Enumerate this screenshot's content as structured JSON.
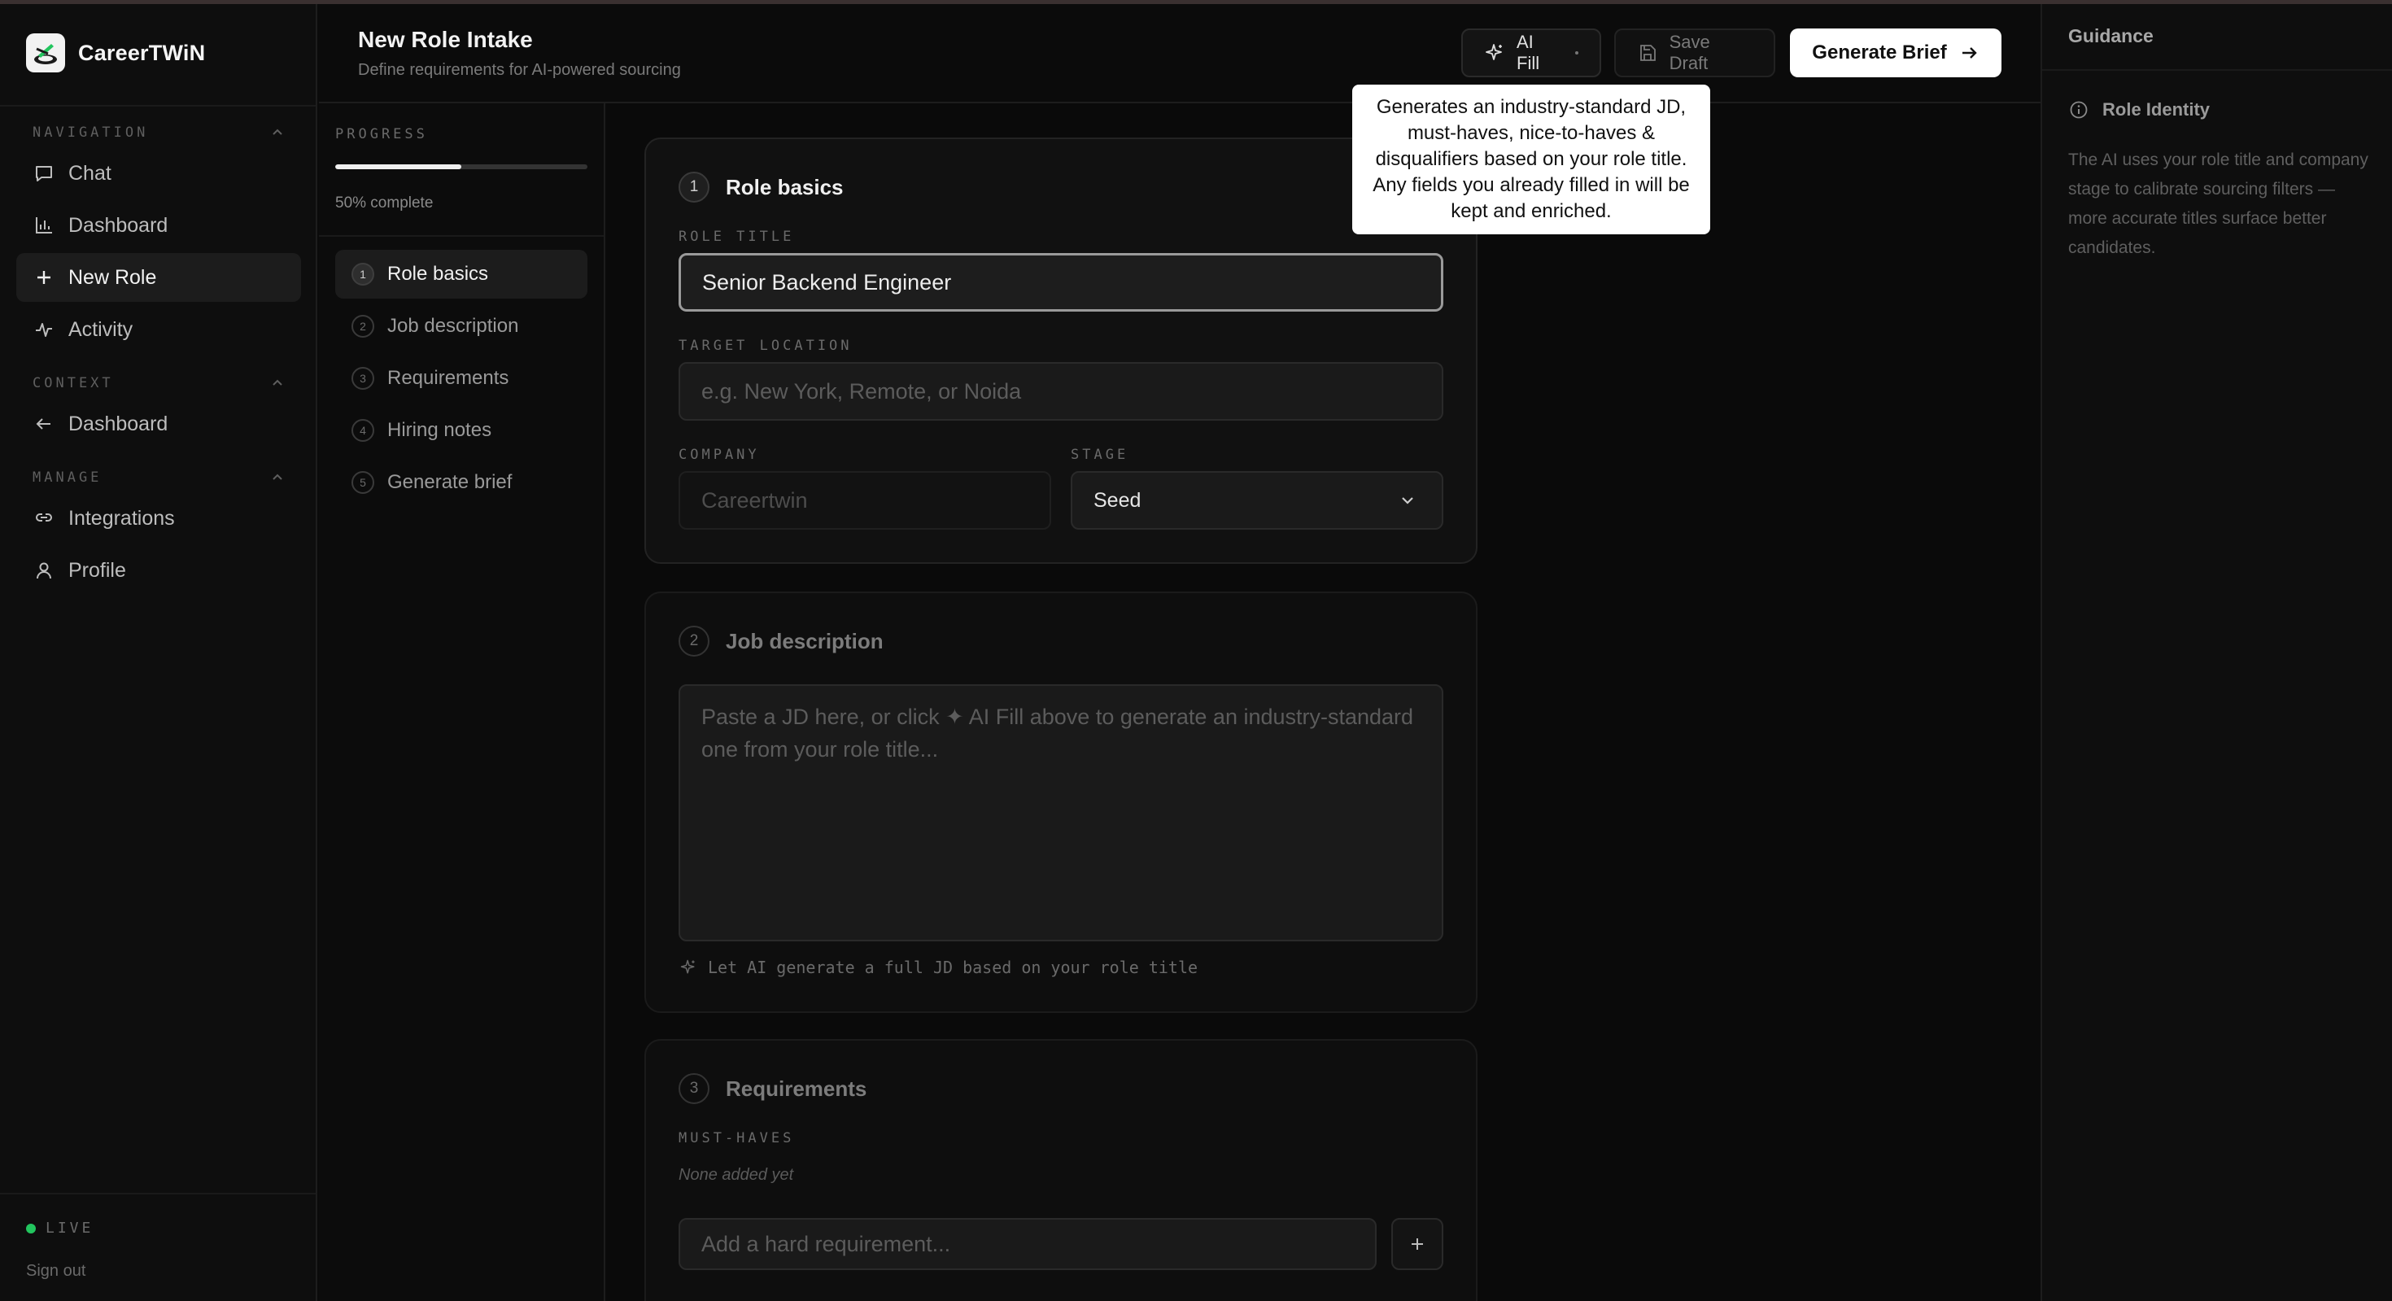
{
  "app": {
    "name_prefix": "CareerTW",
    "name_accent": "i",
    "name_suffix": "N"
  },
  "nav": {
    "section_navigation": "NAVIGATION",
    "section_context": "CONTEXT",
    "section_manage": "MANAGE",
    "items": [
      {
        "label": "Chat",
        "icon": "chat-bubble-icon"
      },
      {
        "label": "Dashboard",
        "icon": "bar-chart-icon"
      },
      {
        "label": "New Role",
        "icon": "plus-icon",
        "active": true
      },
      {
        "label": "Activity",
        "icon": "activity-pulse-icon"
      }
    ],
    "context_items": [
      {
        "label": "Dashboard",
        "icon": "arrow-left-icon"
      }
    ],
    "manage_items": [
      {
        "label": "Integrations",
        "icon": "link-icon"
      },
      {
        "label": "Profile",
        "icon": "user-icon"
      }
    ],
    "live_label": "LIVE",
    "live_color": "#22c55e",
    "signout": "Sign out"
  },
  "header": {
    "title": "New Role Intake",
    "subtitle": "Define requirements for AI-powered sourcing",
    "ai_fill": "AI Fill",
    "save_draft": "Save Draft",
    "generate": "Generate Brief"
  },
  "tooltip": "Generates an industry-standard JD, must-haves, nice-to-haves & disqualifiers based on your role title. Any fields you already filled in will be kept and enriched.",
  "progress": {
    "label": "PROGRESS",
    "percent": 50,
    "text": "50% complete",
    "steps": [
      {
        "num": "1",
        "label": "Role basics",
        "active": true
      },
      {
        "num": "2",
        "label": "Job description"
      },
      {
        "num": "3",
        "label": "Requirements"
      },
      {
        "num": "4",
        "label": "Hiring notes"
      },
      {
        "num": "5",
        "label": "Generate brief"
      }
    ]
  },
  "role_basics": {
    "num": "1",
    "title": "Role basics",
    "role_title_label": "ROLE TITLE",
    "role_title_value": "Senior Backend Engineer",
    "location_label": "TARGET LOCATION",
    "location_placeholder": "e.g. New York, Remote, or Noida",
    "company_label": "COMPANY",
    "company_value": "Careertwin",
    "stage_label": "STAGE",
    "stage_value": "Seed"
  },
  "job_description": {
    "num": "2",
    "title": "Job description",
    "placeholder": "Paste a JD here, or click ✦ AI Fill above to generate an industry-standard one from your role title...",
    "hint": "Let AI generate a full JD based on your role title"
  },
  "requirements": {
    "num": "3",
    "title": "Requirements",
    "must_label": "MUST-HAVES",
    "none_text": "None added yet",
    "add_placeholder": "Add a hard requirement..."
  },
  "guidance": {
    "title": "Guidance",
    "heading": "Role Identity",
    "body": "The AI uses your role title and company stage to calibrate sourcing filters — more accurate titles surface better candidates."
  }
}
